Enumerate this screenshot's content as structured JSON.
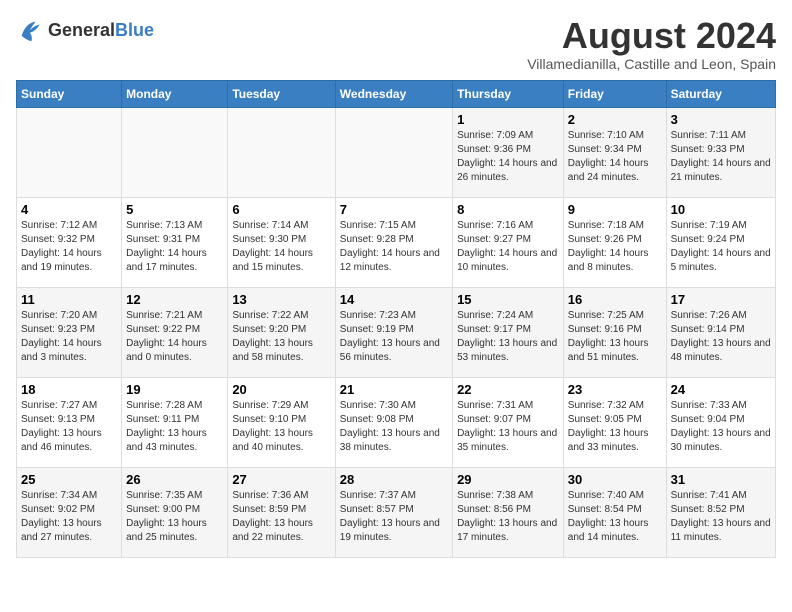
{
  "header": {
    "logo_general": "General",
    "logo_blue": "Blue",
    "main_title": "August 2024",
    "subtitle": "Villamedianilla, Castille and Leon, Spain"
  },
  "calendar": {
    "weekdays": [
      "Sunday",
      "Monday",
      "Tuesday",
      "Wednesday",
      "Thursday",
      "Friday",
      "Saturday"
    ],
    "weeks": [
      [
        {
          "day": "",
          "info": ""
        },
        {
          "day": "",
          "info": ""
        },
        {
          "day": "",
          "info": ""
        },
        {
          "day": "",
          "info": ""
        },
        {
          "day": "1",
          "info": "Sunrise: 7:09 AM\nSunset: 9:36 PM\nDaylight: 14 hours and 26 minutes."
        },
        {
          "day": "2",
          "info": "Sunrise: 7:10 AM\nSunset: 9:34 PM\nDaylight: 14 hours and 24 minutes."
        },
        {
          "day": "3",
          "info": "Sunrise: 7:11 AM\nSunset: 9:33 PM\nDaylight: 14 hours and 21 minutes."
        }
      ],
      [
        {
          "day": "4",
          "info": "Sunrise: 7:12 AM\nSunset: 9:32 PM\nDaylight: 14 hours and 19 minutes."
        },
        {
          "day": "5",
          "info": "Sunrise: 7:13 AM\nSunset: 9:31 PM\nDaylight: 14 hours and 17 minutes."
        },
        {
          "day": "6",
          "info": "Sunrise: 7:14 AM\nSunset: 9:30 PM\nDaylight: 14 hours and 15 minutes."
        },
        {
          "day": "7",
          "info": "Sunrise: 7:15 AM\nSunset: 9:28 PM\nDaylight: 14 hours and 12 minutes."
        },
        {
          "day": "8",
          "info": "Sunrise: 7:16 AM\nSunset: 9:27 PM\nDaylight: 14 hours and 10 minutes."
        },
        {
          "day": "9",
          "info": "Sunrise: 7:18 AM\nSunset: 9:26 PM\nDaylight: 14 hours and 8 minutes."
        },
        {
          "day": "10",
          "info": "Sunrise: 7:19 AM\nSunset: 9:24 PM\nDaylight: 14 hours and 5 minutes."
        }
      ],
      [
        {
          "day": "11",
          "info": "Sunrise: 7:20 AM\nSunset: 9:23 PM\nDaylight: 14 hours and 3 minutes."
        },
        {
          "day": "12",
          "info": "Sunrise: 7:21 AM\nSunset: 9:22 PM\nDaylight: 14 hours and 0 minutes."
        },
        {
          "day": "13",
          "info": "Sunrise: 7:22 AM\nSunset: 9:20 PM\nDaylight: 13 hours and 58 minutes."
        },
        {
          "day": "14",
          "info": "Sunrise: 7:23 AM\nSunset: 9:19 PM\nDaylight: 13 hours and 56 minutes."
        },
        {
          "day": "15",
          "info": "Sunrise: 7:24 AM\nSunset: 9:17 PM\nDaylight: 13 hours and 53 minutes."
        },
        {
          "day": "16",
          "info": "Sunrise: 7:25 AM\nSunset: 9:16 PM\nDaylight: 13 hours and 51 minutes."
        },
        {
          "day": "17",
          "info": "Sunrise: 7:26 AM\nSunset: 9:14 PM\nDaylight: 13 hours and 48 minutes."
        }
      ],
      [
        {
          "day": "18",
          "info": "Sunrise: 7:27 AM\nSunset: 9:13 PM\nDaylight: 13 hours and 46 minutes."
        },
        {
          "day": "19",
          "info": "Sunrise: 7:28 AM\nSunset: 9:11 PM\nDaylight: 13 hours and 43 minutes."
        },
        {
          "day": "20",
          "info": "Sunrise: 7:29 AM\nSunset: 9:10 PM\nDaylight: 13 hours and 40 minutes."
        },
        {
          "day": "21",
          "info": "Sunrise: 7:30 AM\nSunset: 9:08 PM\nDaylight: 13 hours and 38 minutes."
        },
        {
          "day": "22",
          "info": "Sunrise: 7:31 AM\nSunset: 9:07 PM\nDaylight: 13 hours and 35 minutes."
        },
        {
          "day": "23",
          "info": "Sunrise: 7:32 AM\nSunset: 9:05 PM\nDaylight: 13 hours and 33 minutes."
        },
        {
          "day": "24",
          "info": "Sunrise: 7:33 AM\nSunset: 9:04 PM\nDaylight: 13 hours and 30 minutes."
        }
      ],
      [
        {
          "day": "25",
          "info": "Sunrise: 7:34 AM\nSunset: 9:02 PM\nDaylight: 13 hours and 27 minutes."
        },
        {
          "day": "26",
          "info": "Sunrise: 7:35 AM\nSunset: 9:00 PM\nDaylight: 13 hours and 25 minutes."
        },
        {
          "day": "27",
          "info": "Sunrise: 7:36 AM\nSunset: 8:59 PM\nDaylight: 13 hours and 22 minutes."
        },
        {
          "day": "28",
          "info": "Sunrise: 7:37 AM\nSunset: 8:57 PM\nDaylight: 13 hours and 19 minutes."
        },
        {
          "day": "29",
          "info": "Sunrise: 7:38 AM\nSunset: 8:56 PM\nDaylight: 13 hours and 17 minutes."
        },
        {
          "day": "30",
          "info": "Sunrise: 7:40 AM\nSunset: 8:54 PM\nDaylight: 13 hours and 14 minutes."
        },
        {
          "day": "31",
          "info": "Sunrise: 7:41 AM\nSunset: 8:52 PM\nDaylight: 13 hours and 11 minutes."
        }
      ]
    ]
  }
}
